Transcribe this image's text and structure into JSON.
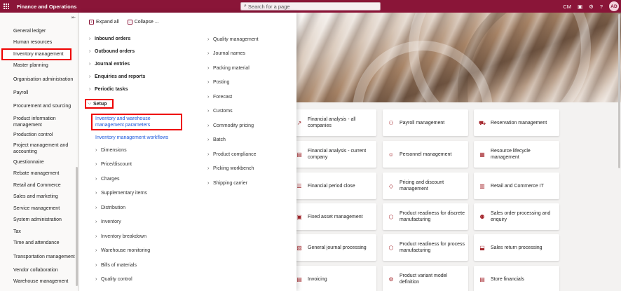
{
  "topbar": {
    "app_title": "Finance and Operations",
    "search_placeholder": "Search for a page",
    "company": "CM",
    "avatar": "AD",
    "icons": [
      "app-launcher-icon",
      "search-icon",
      "chat-icon",
      "settings-icon",
      "help-icon"
    ]
  },
  "leftnav": {
    "items": [
      {
        "label": "General ledger"
      },
      {
        "label": "Human resources"
      },
      {
        "label": "Inventory management",
        "selected": true
      },
      {
        "label": "Master planning"
      },
      {
        "label": "Organisation administration"
      },
      {
        "label": "Payroll"
      },
      {
        "label": "Procurement and sourcing"
      },
      {
        "label": "Product information management"
      },
      {
        "label": "Production control"
      },
      {
        "label": "Project management and accounting"
      },
      {
        "label": "Questionnaire"
      },
      {
        "label": "Rebate management"
      },
      {
        "label": "Retail and Commerce"
      },
      {
        "label": "Sales and marketing"
      },
      {
        "label": "Service management"
      },
      {
        "label": "System administration"
      },
      {
        "label": "Tax"
      },
      {
        "label": "Time and attendance"
      },
      {
        "label": "Transportation management"
      },
      {
        "label": "Vendor collaboration"
      },
      {
        "label": "Warehouse management"
      }
    ]
  },
  "flyout": {
    "expand_all": "Expand all",
    "collapse": "Collapse ...",
    "col1_groups": [
      "Inbound orders",
      "Outbound orders",
      "Journal entries",
      "Enquiries and reports",
      "Periodic tasks"
    ],
    "setup_label": "Setup",
    "setup_link_1": "Inventory and warehouse management parameters",
    "setup_link_2": "Inventory management workflows",
    "setup_subgroups": [
      "Dimensions",
      "Price/discount",
      "Charges",
      "Supplementary items",
      "Distribution",
      "Inventory",
      "Inventory breakdown",
      "Warehouse monitoring",
      "Bills of materials",
      "Quality control"
    ],
    "col2_groups": [
      "Quality management",
      "Journal names",
      "Packing material",
      "Posting",
      "Forecast",
      "Customs",
      "Commodity pricing",
      "Batch",
      "Product compliance",
      "Picking workbench",
      "Shipping carrier"
    ]
  },
  "tiles": [
    {
      "label": "Financial analysis - all companies",
      "icon": "trend-icon"
    },
    {
      "label": "Payroll management",
      "icon": "people-icon"
    },
    {
      "label": "Reservation management",
      "icon": "car-icon"
    },
    {
      "label": "Financial analysis - current company",
      "icon": "document-icon"
    },
    {
      "label": "Personnel management",
      "icon": "person-icon"
    },
    {
      "label": "Resource lifecycle management",
      "icon": "building-icon"
    },
    {
      "label": "Financial period close",
      "icon": "list-icon"
    },
    {
      "label": "Pricing and discount management",
      "icon": "tag-icon"
    },
    {
      "label": "Retail and Commerce IT",
      "icon": "store-icon"
    },
    {
      "label": "Fixed asset management",
      "icon": "asset-icon"
    },
    {
      "label": "Product readiness for discrete manufacturing",
      "icon": "product-icon"
    },
    {
      "label": "Sales order processing and enquiry",
      "icon": "person-cart-icon"
    },
    {
      "label": "General journal processing",
      "icon": "journal-icon"
    },
    {
      "label": "Product readiness for process manufacturing",
      "icon": "product-icon"
    },
    {
      "label": "Sales return processing",
      "icon": "box-return-icon"
    },
    {
      "label": "Invoicing",
      "icon": "invoice-icon"
    },
    {
      "label": "Product variant model definition",
      "icon": "variant-icon"
    },
    {
      "label": "Store financials",
      "icon": "store-financials-icon"
    }
  ]
}
